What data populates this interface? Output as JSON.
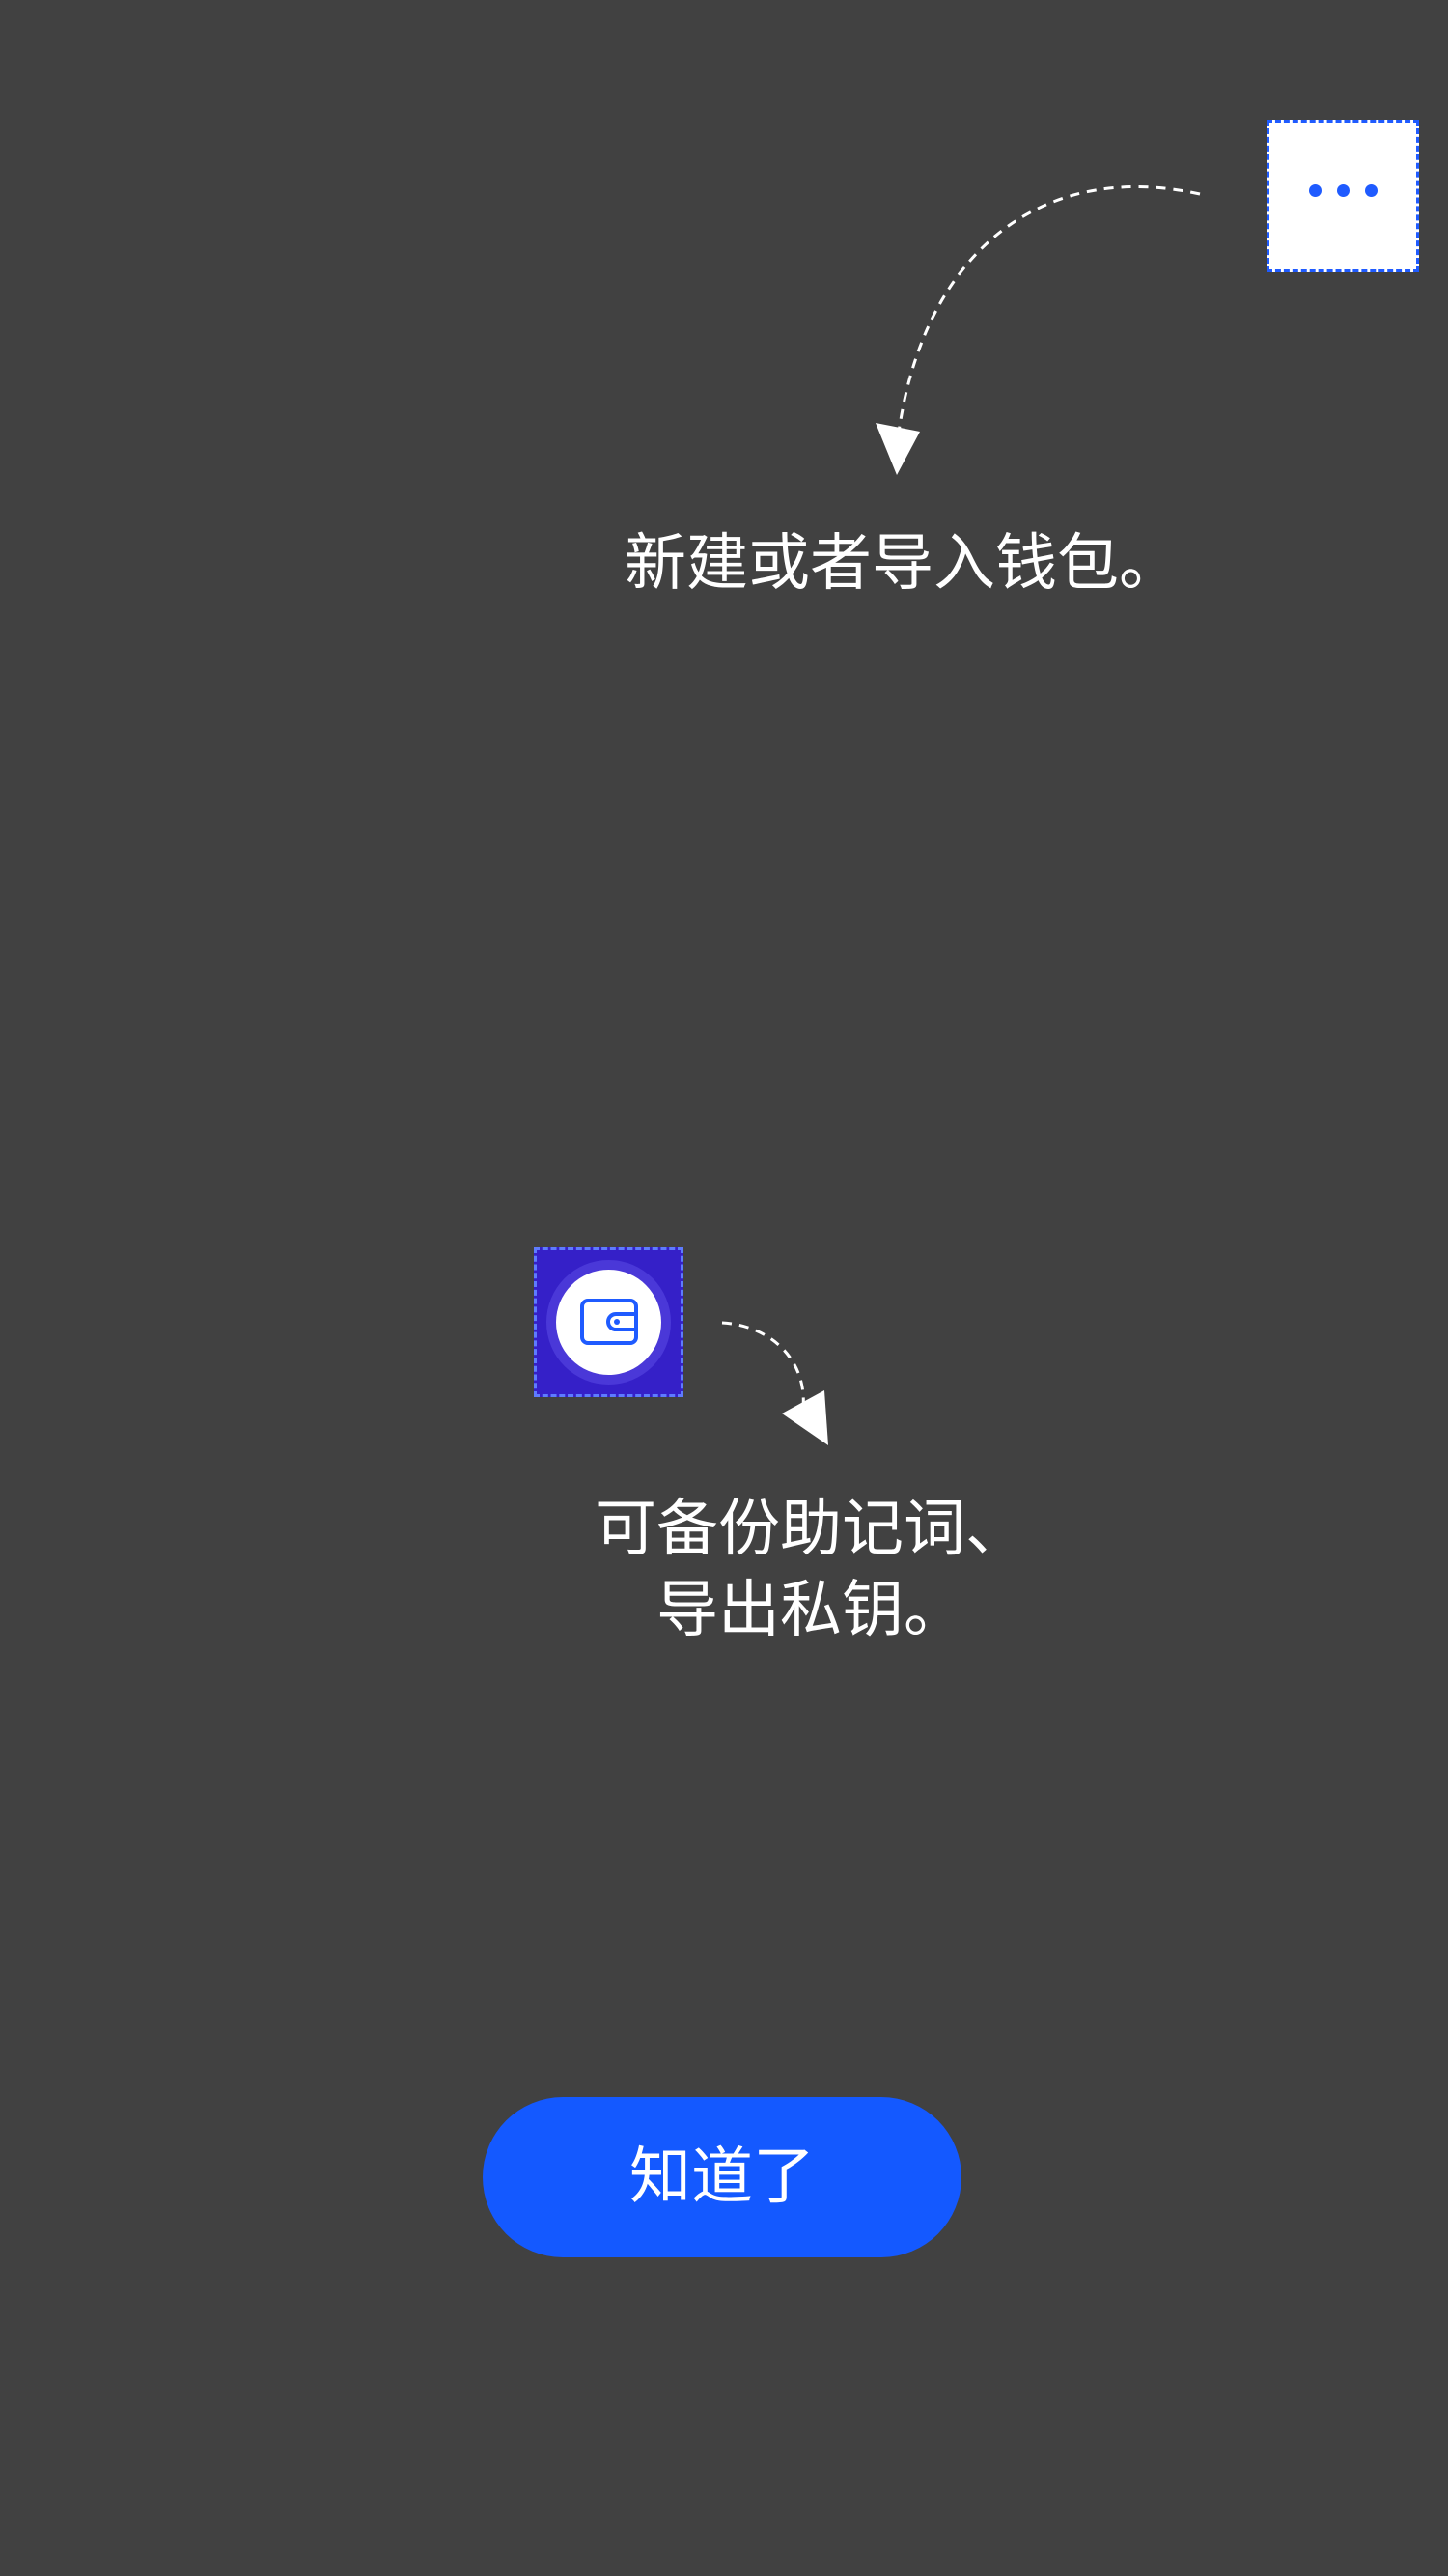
{
  "overlay": {
    "background": "#414141",
    "accent": "#1459ff"
  },
  "more_button": {
    "icon": "more-dots-icon"
  },
  "hint_more": {
    "text": "新建或者导入钱包。"
  },
  "wallet_button": {
    "icon": "wallet-icon",
    "background": "#3520c8"
  },
  "hint_wallet": {
    "line1": "可备份助记词、",
    "line2": "导出私钥。"
  },
  "confirm_button": {
    "label": "知道了"
  }
}
